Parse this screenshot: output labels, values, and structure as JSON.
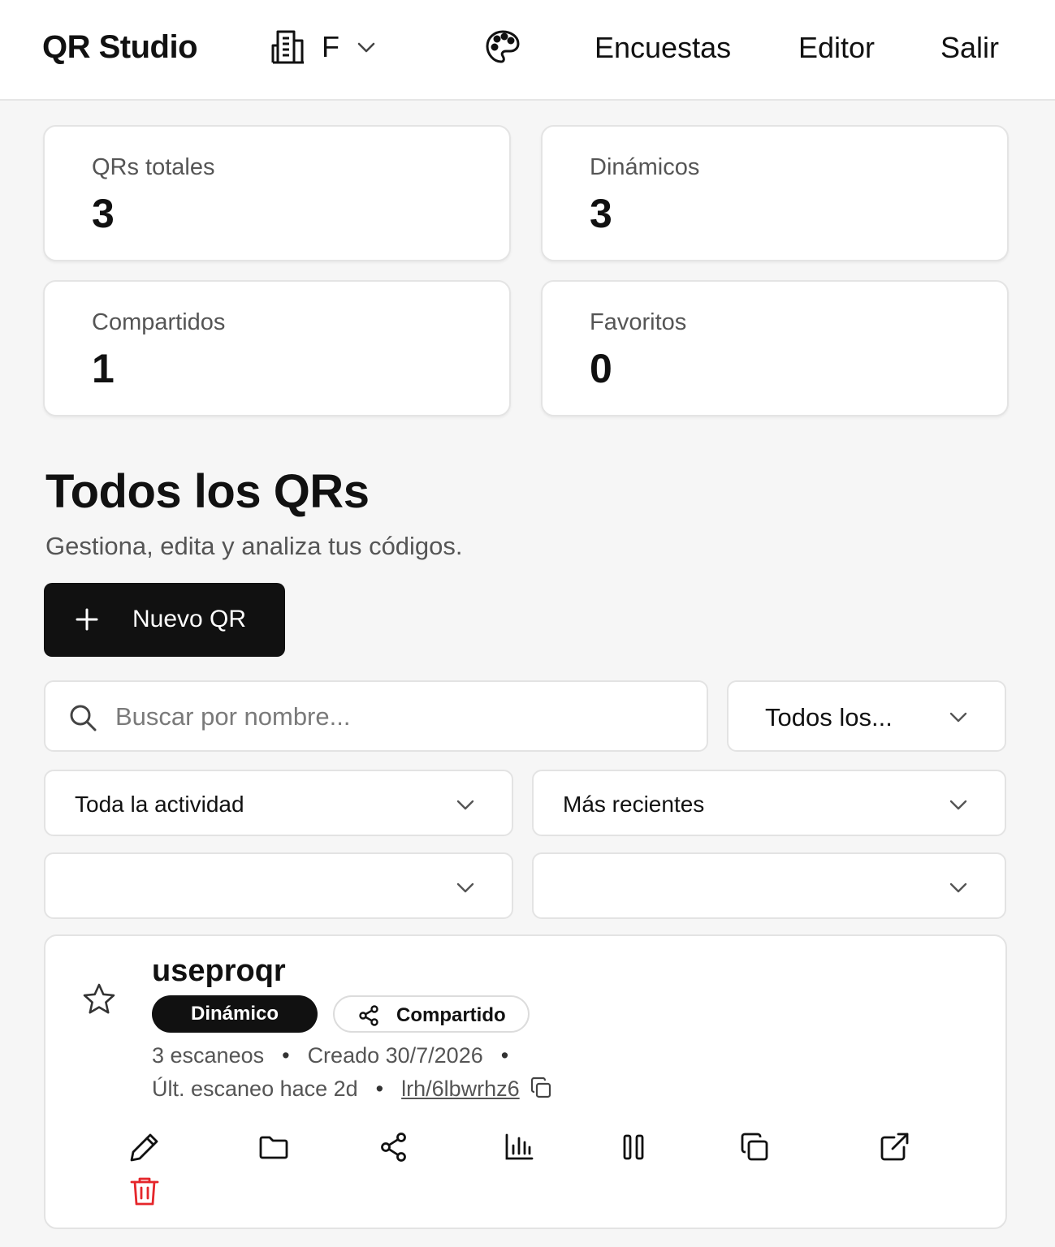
{
  "header": {
    "brand": "QR Studio",
    "org_letter": "F",
    "nav": {
      "encuestas": "Encuestas",
      "editor": "Editor",
      "salir": "Salir"
    }
  },
  "stats": [
    {
      "label": "QRs totales",
      "value": "3"
    },
    {
      "label": "Dinámicos",
      "value": "3"
    },
    {
      "label": "Compartidos",
      "value": "1"
    },
    {
      "label": "Favoritos",
      "value": "0"
    }
  ],
  "section": {
    "title": "Todos los QRs",
    "subtitle": "Gestiona, edita y analiza tus códigos."
  },
  "new_button_label": "Nuevo QR",
  "filters": {
    "search_placeholder": "Buscar por nombre...",
    "search_value": "",
    "type_select": "Todos los...",
    "activity_select": "Toda la actividad",
    "sort_select": "Más recientes",
    "extra_select_1": "",
    "extra_select_2": ""
  },
  "qr_item": {
    "name": "useproqr",
    "favorite": false,
    "badge_type": "Dinámico",
    "badge_shared": "Compartido",
    "scans": "3 escaneos",
    "created": "Creado 30/7/2026",
    "last_scan": "Últ. escaneo hace 2d",
    "short_link": "lrh/6lbwrhz6"
  },
  "icons": {
    "org": "building-icon",
    "palette": "palette-icon",
    "search": "search-icon",
    "star": "star-icon",
    "share": "share-icon",
    "copy": "copy-icon",
    "edit": "pencil-icon",
    "folder": "folder-icon",
    "stats": "bar-chart-icon",
    "pause": "pause-icon",
    "duplicate": "duplicate-icon",
    "open": "external-link-icon",
    "delete": "trash-icon"
  },
  "colors": {
    "primary": "#111111",
    "background": "#f6f6f6",
    "danger": "#e5262b",
    "muted_text": "#555555"
  }
}
